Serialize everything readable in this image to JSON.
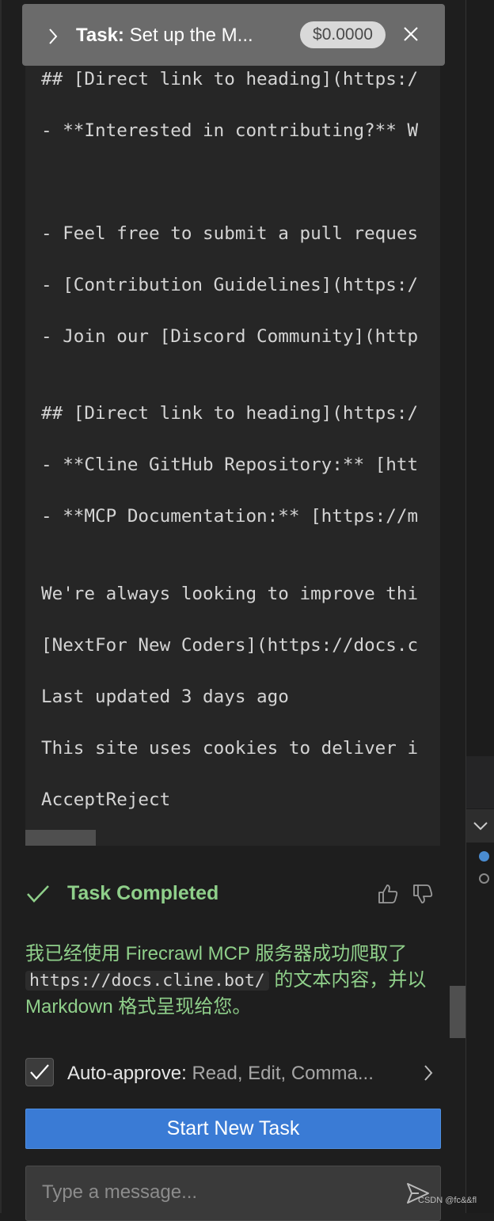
{
  "task": {
    "label": "Task:",
    "title": "Set up the M...",
    "cost": "$0.0000"
  },
  "code_lines": [
    "## [Direct link to heading](https:/",
    "- **Interested in contributing?** W",
    "- Feel free to submit a pull reques",
    "- [Contribution Guidelines](https:/",
    "- Join our [Discord Community](http",
    "## [Direct link to heading](https:/",
    "- **Cline GitHub Repository:** [htt",
    "- **MCP Documentation:** [https://m",
    "We're always looking to improve thi",
    "[NextFor New Coders](https://docs.c",
    "Last updated 3 days ago",
    "This site uses cookies to deliver i",
    "AcceptReject"
  ],
  "completion": {
    "label": "Task Completed",
    "message_before": "我已经使用 Firecrawl MCP 服务器成功爬取了 ",
    "message_code": "https://docs.cline.bot/",
    "message_after": " 的文本内容，并以 Markdown 格式呈现给您。"
  },
  "auto_approve": {
    "label": "Auto-approve:",
    "value": "Read, Edit, Comma..."
  },
  "start_button": "Start New Task",
  "message_input": {
    "placeholder": "Type a message...",
    "value": ""
  },
  "watermark": "CSDN @fc&&fl",
  "icons": [
    "chevron-right-icon",
    "close-icon",
    "check-icon",
    "thumbs-up-icon",
    "thumbs-down-icon",
    "chevron-down-icon",
    "send-icon"
  ],
  "colors": {
    "background": "#1e1e1e",
    "header": "#6b6b6b",
    "success": "#8fcf8a",
    "button": "#3a7bd5"
  }
}
